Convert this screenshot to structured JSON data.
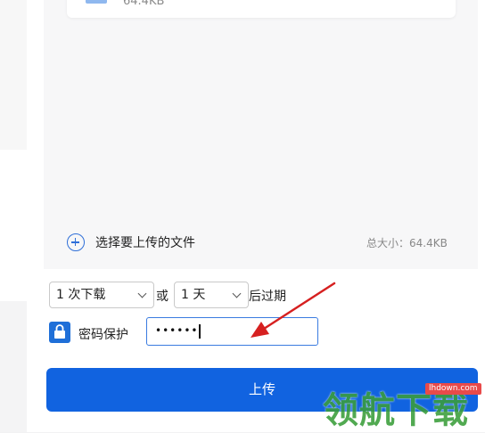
{
  "file": {
    "size": "64.4KB",
    "icon": "file-icon"
  },
  "dropzone": {
    "add_label": "选择要上传的文件",
    "total_size": "总大小：64.4KB"
  },
  "expiry": {
    "downloads_value": "1 次下载",
    "or_text": "或",
    "days_value": "1 天",
    "suffix_text": "后过期"
  },
  "password": {
    "label": "密码保护",
    "value": "••••••",
    "enabled": true
  },
  "upload_button": {
    "label": "上传"
  },
  "watermark": {
    "text": "领航下载",
    "url": "lhdown.com"
  },
  "colors": {
    "primary": "#1163e0",
    "accent_border": "#3a7be0",
    "annotation_arrow": "#d62020"
  }
}
